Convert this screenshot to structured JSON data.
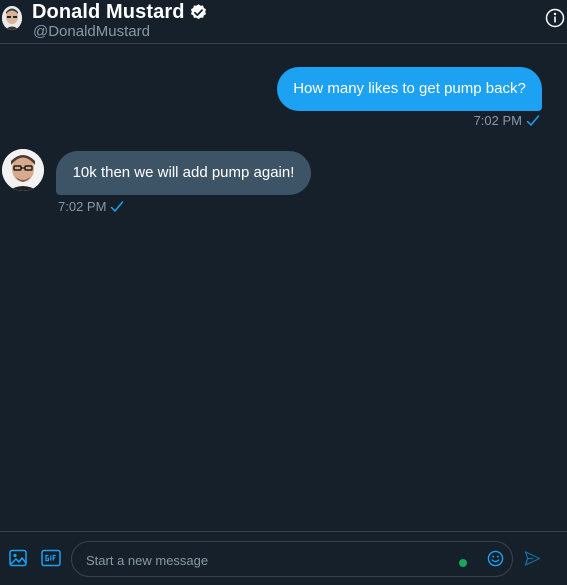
{
  "header": {
    "name": "Donald Mustard",
    "handle": "@DonaldMustard",
    "verified_icon": "verified-badge-icon",
    "info_icon": "info-icon"
  },
  "messages": [
    {
      "direction": "outgoing",
      "text": "How many likes to get pump back?",
      "time": "7:02 PM",
      "status_icon": "read-check-icon"
    },
    {
      "direction": "incoming",
      "text": "10k then we will add pump again!",
      "time": "7:02 PM",
      "status_icon": "read-check-icon"
    }
  ],
  "composer": {
    "placeholder": "Start a new message",
    "value": "",
    "media_icon": "image-icon",
    "gif_icon": "gif-icon",
    "emoji_icon": "emoji-icon",
    "send_icon": "send-icon"
  },
  "colors": {
    "background": "#15202b",
    "accent": "#1da1f2",
    "incoming_bubble": "#3d5466",
    "muted_text": "#8899a6",
    "border": "#38444d"
  }
}
